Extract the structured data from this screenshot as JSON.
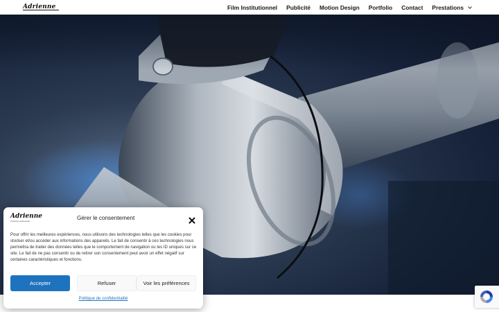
{
  "header": {
    "logo": "Adrienne",
    "nav": [
      {
        "label": "Film Institutionnel"
      },
      {
        "label": "Publicité"
      },
      {
        "label": "Motion Design"
      },
      {
        "label": "Portfolio"
      },
      {
        "label": "Contact"
      },
      {
        "label": "Prestations",
        "icon": "chevron-down-icon"
      }
    ]
  },
  "hero": {
    "image": "robotic-arm-photo",
    "colors": {
      "dark": "#0e1729",
      "metal": "#9aa3ad",
      "accent_blue": "#3f7fd1"
    }
  },
  "cookie_modal": {
    "logo": "Adrienne",
    "logo_tagline": "Production audiovisuelle",
    "title": "Gérer le consentement",
    "body": "Pour offrir les meilleures expériences, nous utilisons des technologies telles que les cookies pour stocker et/ou accéder aux informations des appareils. Le fait de consentir à ces technologies nous permettra de traiter des données telles que le comportement de navigation ou les ID uniques sur ce site. Le fait de ne pas consentir ou de retirer son consentement peut avoir un effet négatif sur certaines caractéristiques et fonctions.",
    "accept_label": "Accepter",
    "refuse_label": "Refuser",
    "preferences_label": "Voir les préférences",
    "policy_link": "Politique de confidentialité",
    "accent_color": "#1e73be"
  },
  "recaptcha": {
    "icon": "recaptcha-icon"
  }
}
